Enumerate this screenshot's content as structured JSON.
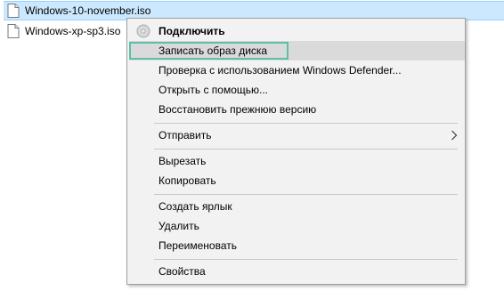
{
  "files": [
    {
      "name": "Windows-10-november.iso",
      "selected": true
    },
    {
      "name": "Windows-xp-sp3.iso",
      "selected": false
    }
  ],
  "menu": {
    "mount": "Подключить",
    "burn": "Записать образ диска",
    "defender": "Проверка с использованием Windows Defender...",
    "open_with": "Открыть с помощью...",
    "restore": "Восстановить прежнюю версию",
    "send_to": "Отправить",
    "cut": "Вырезать",
    "copy": "Копировать",
    "create_shortcut": "Создать ярлык",
    "delete": "Удалить",
    "rename": "Переименовать",
    "properties": "Свойства"
  },
  "icons": {
    "file": "document-icon",
    "disc": "disc-icon",
    "submenu": "chevron-right-icon"
  },
  "colors": {
    "selection": "#cce8ff",
    "highlight_outline": "#5cc0a8",
    "menu_bg": "#f2f2f2",
    "hover_bg": "#dadada"
  }
}
